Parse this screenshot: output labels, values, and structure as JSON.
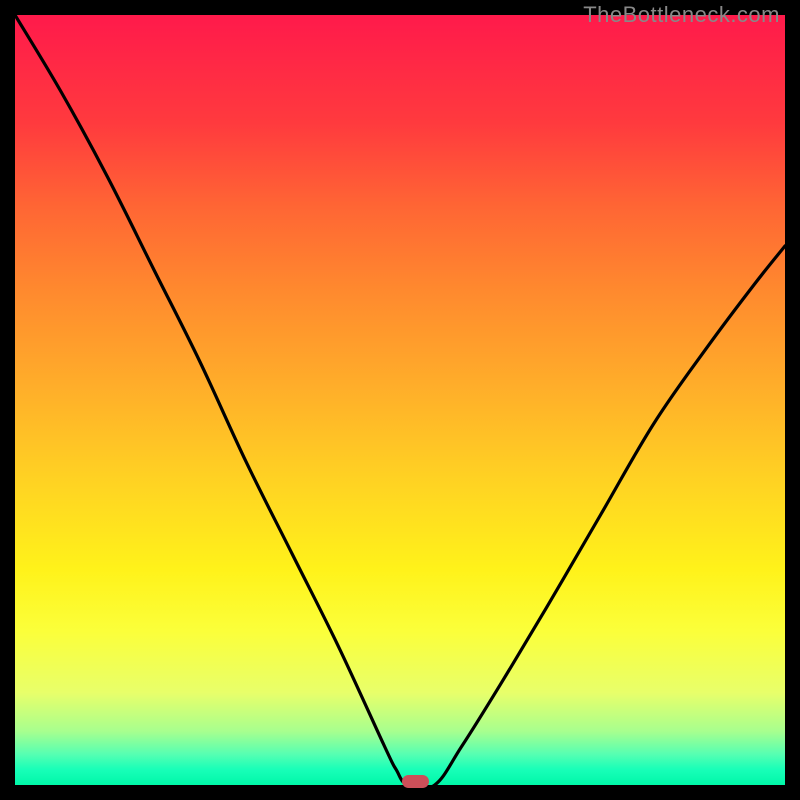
{
  "watermark": "TheBottleneck.com",
  "colors": {
    "frame": "#000000",
    "curve": "#000000",
    "marker": "#cc4f59",
    "gradient_stops": [
      "#ff1a4b",
      "#ff3a3e",
      "#ff6634",
      "#ff8a2e",
      "#ffad2a",
      "#ffd123",
      "#fff21a",
      "#fbff3a",
      "#e8ff6a",
      "#a8ff8e",
      "#56ffb2",
      "#18ffb8",
      "#00f7a8"
    ]
  },
  "chart_data": {
    "type": "line",
    "title": "",
    "xlabel": "",
    "ylabel": "",
    "xlim": [
      0,
      100
    ],
    "ylim": [
      0,
      100
    ],
    "legend": false,
    "grid": false,
    "marker": {
      "x": 52,
      "y": 0
    },
    "series": [
      {
        "name": "left-curve",
        "x": [
          0,
          6,
          12,
          18,
          24,
          30,
          36,
          42,
          48,
          49.5,
          51
        ],
        "y": [
          100,
          90,
          79,
          67,
          55,
          42,
          30,
          18,
          5,
          2,
          0
        ]
      },
      {
        "name": "valley-floor",
        "x": [
          51,
          54.5
        ],
        "y": [
          0,
          0
        ]
      },
      {
        "name": "right-curve",
        "x": [
          54.5,
          58,
          63,
          69,
          76,
          83,
          90,
          96,
          100
        ],
        "y": [
          0,
          5,
          13,
          23,
          35,
          47,
          57,
          65,
          70
        ]
      }
    ]
  }
}
